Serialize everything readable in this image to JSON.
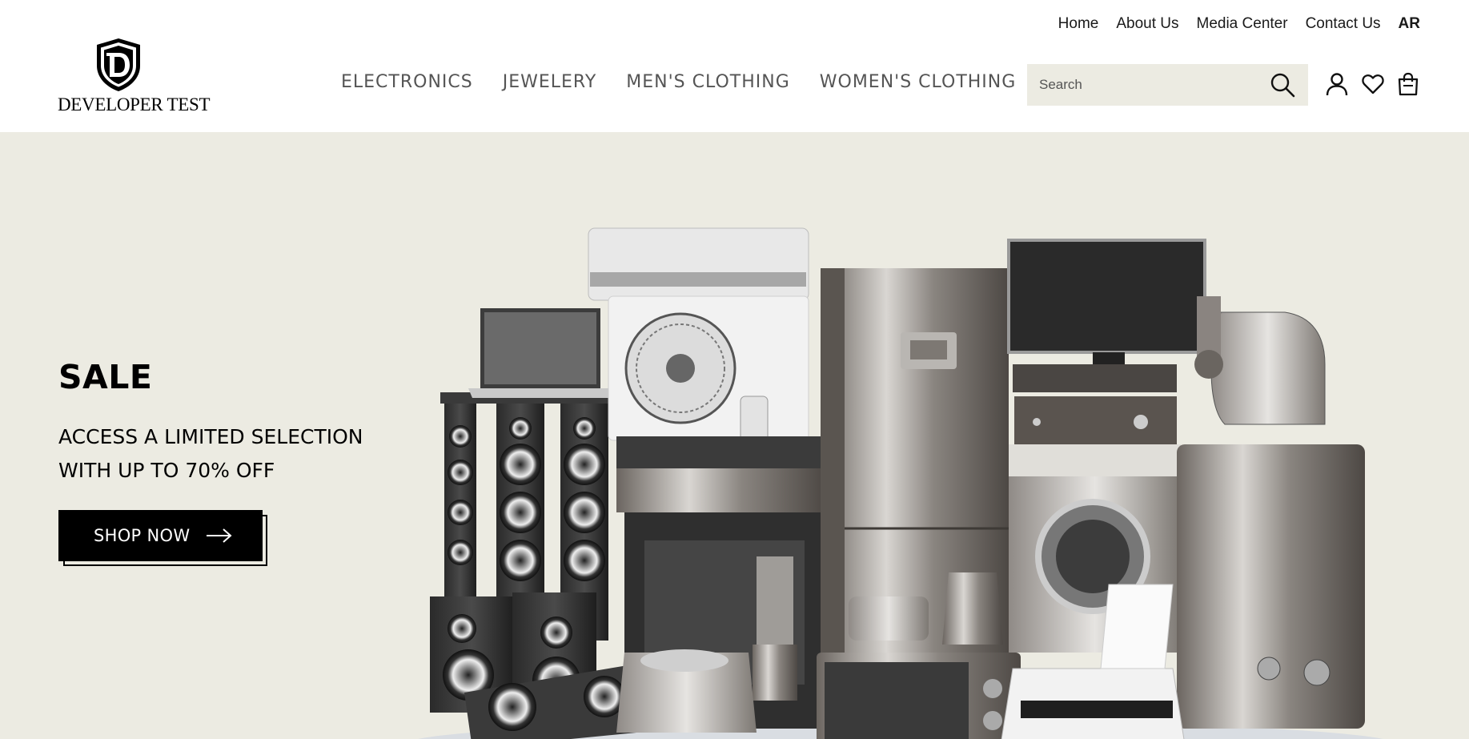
{
  "brand": {
    "name": "DEVELOPER TEST",
    "logo_icon": "shield-dt-monogram-icon"
  },
  "top_links": [
    {
      "label": "Home"
    },
    {
      "label": "About Us"
    },
    {
      "label": "Media Center"
    },
    {
      "label": "Contact Us"
    },
    {
      "label": "AR"
    }
  ],
  "main_nav": [
    {
      "label": "ELECTRONICS"
    },
    {
      "label": "JEWELERY"
    },
    {
      "label": "MEN'S CLOTHING"
    },
    {
      "label": "WOMEN'S CLOTHING"
    }
  ],
  "search": {
    "placeholder": "Search",
    "value": "",
    "icon": "search-icon"
  },
  "header_icons": [
    "user-icon",
    "heart-icon",
    "shopping-bag-icon"
  ],
  "hero": {
    "title": "SALE",
    "subtitle_lines": [
      "ACCESS A LIMITED SELECTION",
      "WITH UP TO 70% OFF"
    ],
    "cta_label": "SHOP NOW",
    "cta_icon": "arrow-right-icon",
    "image_subject": "home-appliances-image"
  },
  "colors": {
    "hero_bg": "#ecebe2",
    "search_bg": "#ecebe2",
    "cta_bg": "#000000",
    "nav_text": "#555555"
  }
}
